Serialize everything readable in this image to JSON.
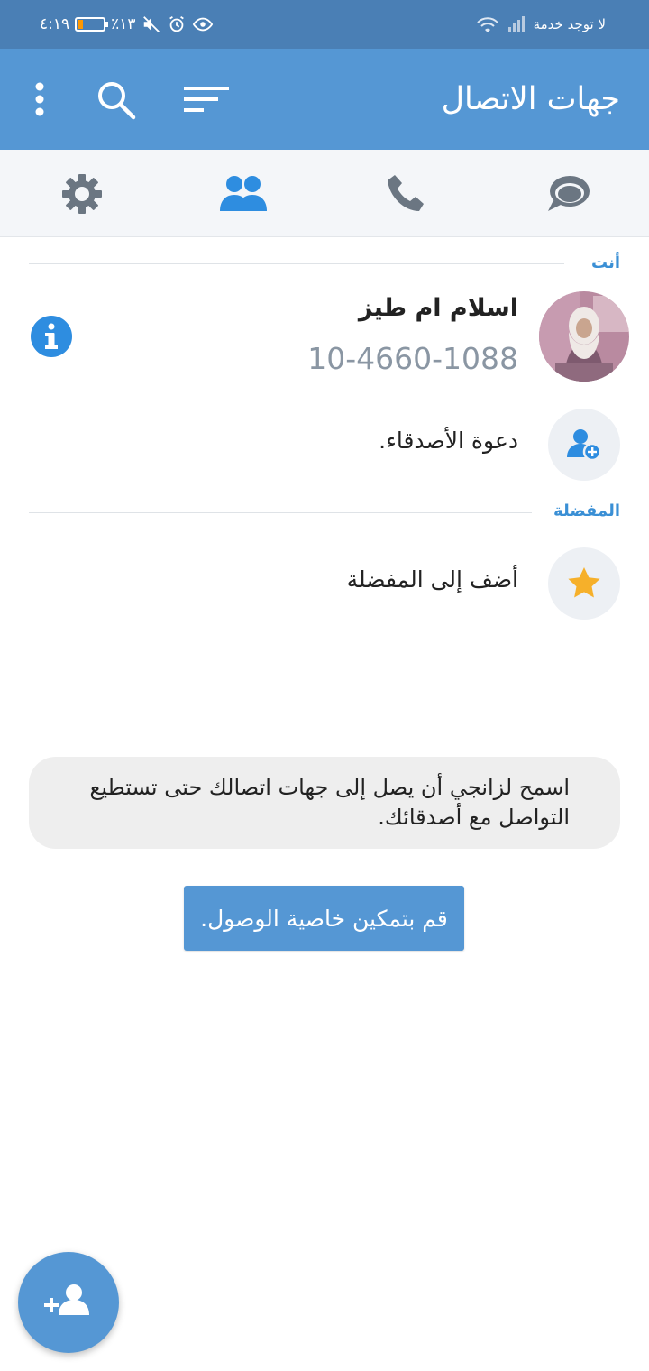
{
  "status_bar": {
    "time": "٤:١٩",
    "battery": "٪١٣",
    "carrier": "لا توجد خدمة",
    "battery_level": 0.13
  },
  "app_bar": {
    "title": "جهات الاتصال",
    "icons": [
      "more-vert-icon",
      "search-icon",
      "sort-icon"
    ]
  },
  "tabs": {
    "items": [
      "chats-tab",
      "calls-tab",
      "contacts-tab",
      "settings-tab"
    ],
    "active": "contacts-tab"
  },
  "you_section": {
    "label": "أنت",
    "name": "اسلام  ام طيز",
    "phone": "10-4660-1088"
  },
  "invite": {
    "label": "دعوة الأصدقاء."
  },
  "favorites_section": {
    "label": "المفضلة",
    "add_label": "أضف إلى المفضلة"
  },
  "permission": {
    "message": "اسمح لزانجي أن يصل إلى جهات اتصالك حتى تستطيع التواصل مع أصدقائك.",
    "button": "قم بتمكين خاصية الوصول."
  },
  "colors": {
    "app_bar": "#5597d4",
    "status_bar": "#4a7fb5",
    "accent": "#3a8fd5",
    "star": "#f6b02a"
  }
}
